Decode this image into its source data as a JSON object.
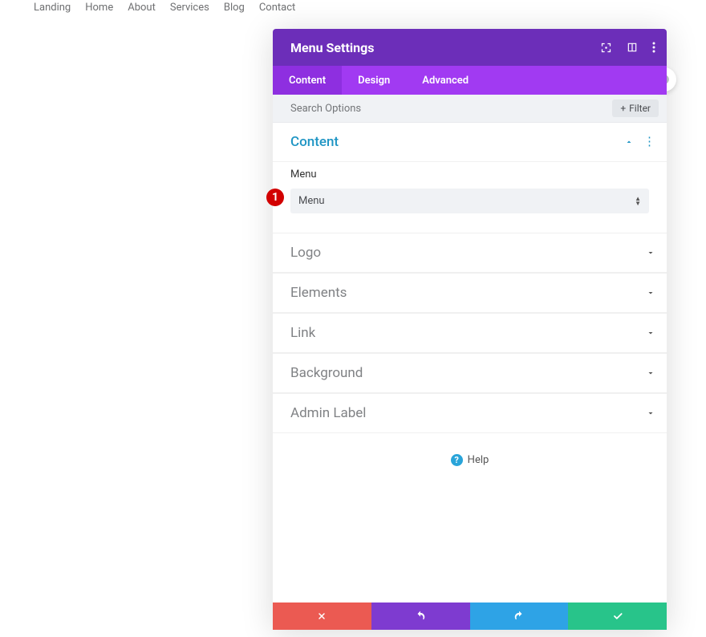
{
  "nav": {
    "items": [
      "Landing",
      "Home",
      "About",
      "Services",
      "Blog",
      "Contact"
    ]
  },
  "panel": {
    "title": "Menu Settings",
    "tabs": [
      {
        "label": "Content",
        "active": true
      },
      {
        "label": "Design",
        "active": false
      },
      {
        "label": "Advanced",
        "active": false
      }
    ],
    "search_placeholder": "Search Options",
    "filter_label": "Filter",
    "sections": {
      "content": {
        "title": "Content",
        "field_label": "Menu",
        "selected_value": "Menu",
        "badge": "1"
      },
      "collapsed": [
        {
          "title": "Logo"
        },
        {
          "title": "Elements"
        },
        {
          "title": "Link"
        },
        {
          "title": "Background"
        },
        {
          "title": "Admin Label"
        }
      ]
    },
    "help_label": "Help"
  },
  "colors": {
    "titlebar": "#6c2eb9",
    "tabbar": "#a13af2",
    "tab_active": "#8e2fe0",
    "badge": "#d20000",
    "cancel": "#eb5a52",
    "undo": "#7e3bd0",
    "redo": "#2ea3e6",
    "ok": "#28c48a",
    "help": "#29a4d9"
  }
}
